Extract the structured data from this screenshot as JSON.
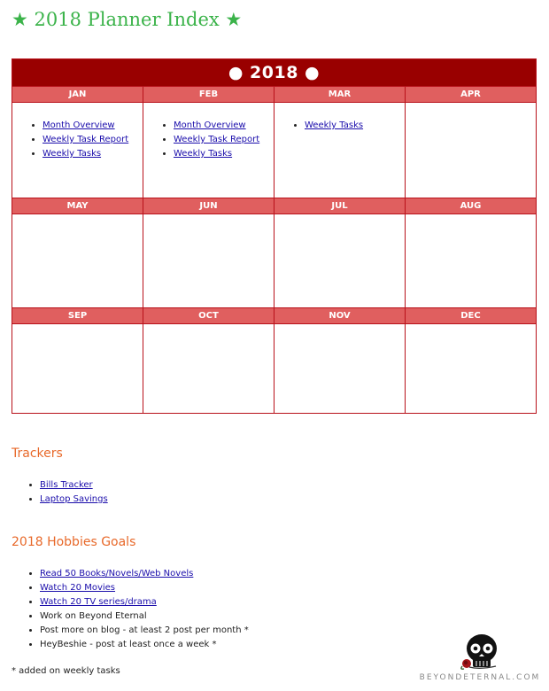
{
  "title": "★ 2018 Planner Index ★",
  "calendar": {
    "year": "● 2018 ●",
    "rows": [
      [
        {
          "month": "JAN",
          "links": [
            "Month Overview",
            "Weekly Task Report",
            "Weekly Tasks"
          ]
        },
        {
          "month": "FEB",
          "links": [
            "Month Overview",
            "Weekly Task Report",
            "Weekly Tasks"
          ]
        },
        {
          "month": "MAR",
          "links": [
            "Weekly Tasks"
          ]
        },
        {
          "month": "APR",
          "links": []
        }
      ],
      [
        {
          "month": "MAY",
          "links": []
        },
        {
          "month": "JUN",
          "links": []
        },
        {
          "month": "JUL",
          "links": []
        },
        {
          "month": "AUG",
          "links": []
        }
      ],
      [
        {
          "month": "SEP",
          "links": []
        },
        {
          "month": "OCT",
          "links": []
        },
        {
          "month": "NOV",
          "links": []
        },
        {
          "month": "DEC",
          "links": []
        }
      ]
    ]
  },
  "trackers": {
    "heading": "Trackers",
    "items": [
      "Bills Tracker",
      "Laptop Savings"
    ]
  },
  "hobbies": {
    "heading": "2018 Hobbies Goals",
    "items": [
      {
        "text": "Read 50 Books/Novels/Web Novels",
        "link": true
      },
      {
        "text": "Watch 20 Movies",
        "link": true
      },
      {
        "text": "Watch 20 TV series/drama",
        "link": true
      },
      {
        "text": "Work on Beyond Eternal",
        "link": false
      },
      {
        "text": "Post more on blog - at least 2 post per month *",
        "link": false
      },
      {
        "text": "HeyBeshie - post at least once a week *",
        "link": false
      }
    ]
  },
  "footnote": "* added on weekly tasks",
  "logo": {
    "text": "BEYONDETERNAL.COM",
    "icon": "skull-rose-icon"
  },
  "colors": {
    "title": "#3bb34a",
    "year_header": "#990000",
    "month_header": "#e05f5f",
    "section_heading": "#e8692a",
    "link": "#1a0dab"
  }
}
